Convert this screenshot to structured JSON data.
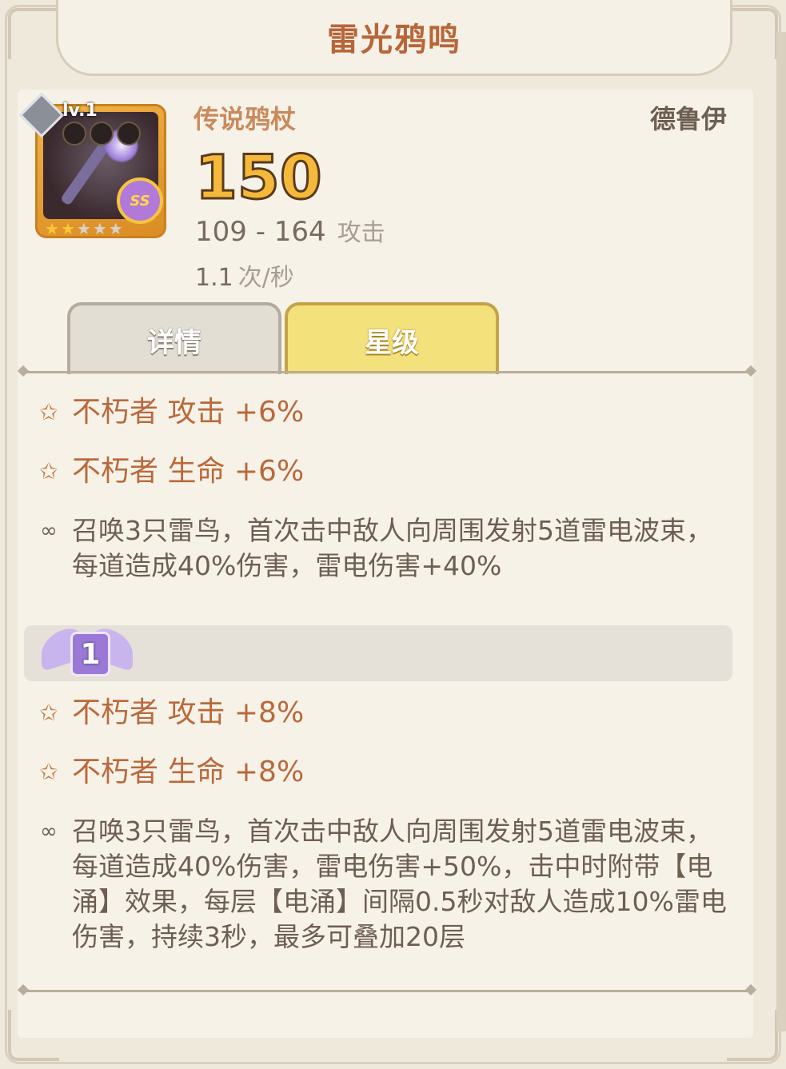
{
  "title": "雷光鸦鸣",
  "weapon": {
    "level": "lv.1",
    "grade_badge": "SS",
    "stars_filled": 2,
    "stars_total": 5,
    "type": "传说鸦杖",
    "class": "德鲁伊",
    "damage": "150",
    "damage_range": "109 - 164",
    "damage_unit": "攻击",
    "attack_speed": "1.1",
    "attack_speed_unit": "次/秒"
  },
  "tabs": [
    {
      "label": "详情",
      "active": false
    },
    {
      "label": "星级",
      "active": true
    }
  ],
  "tier0": {
    "stats": [
      {
        "icon": "star-outline-icon",
        "text": "不朽者 攻击 +6%"
      },
      {
        "icon": "star-outline-icon",
        "text": "不朽者 生命 +6%"
      }
    ],
    "skill": {
      "icon": "chain-link-icon",
      "text": "召唤3只雷鸟，首次击中敌人向周围发射5道雷电波束，每道造成40%伤害，雷电伤害+40%"
    }
  },
  "tier1": {
    "badge": "1",
    "stats": [
      {
        "icon": "star-outline-icon",
        "text": "不朽者 攻击 +8%"
      },
      {
        "icon": "star-outline-icon",
        "text": "不朽者 生命 +8%"
      }
    ],
    "skill": {
      "icon": "chain-link-icon",
      "text": "召唤3只雷鸟，首次击中敌人向周围发射5道雷电波束，每道造成40%伤害，雷电伤害+50%，击中时附带【电涌】效果，每层【电涌】间隔0.5秒对敌人造成10%雷电伤害，持续3秒，最多可叠加20层"
    }
  },
  "colors": {
    "accent": "#b9693c",
    "gold": "#f4b93b",
    "active_tab": "#f3e17b",
    "text_dark": "#6e5e52"
  }
}
